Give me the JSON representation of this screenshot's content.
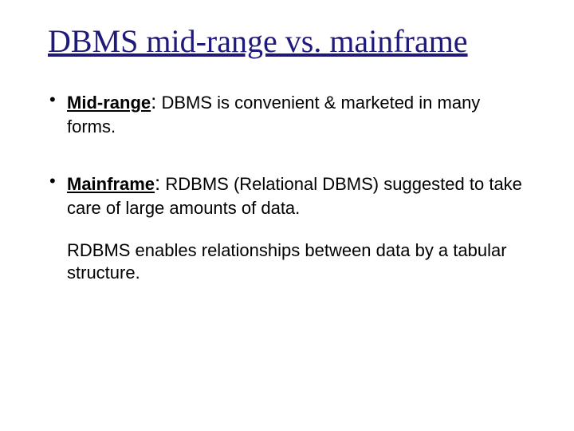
{
  "title": "DBMS mid-range vs. mainframe",
  "bullets": [
    {
      "term": "Mid-range",
      "body": " DBMS is convenient & marketed in many forms."
    },
    {
      "term": "Mainframe",
      "body": " RDBMS (Relational DBMS) suggested to take care of large amounts of data.",
      "extra": "RDBMS enables relationships between data by a tabular structure."
    }
  ]
}
